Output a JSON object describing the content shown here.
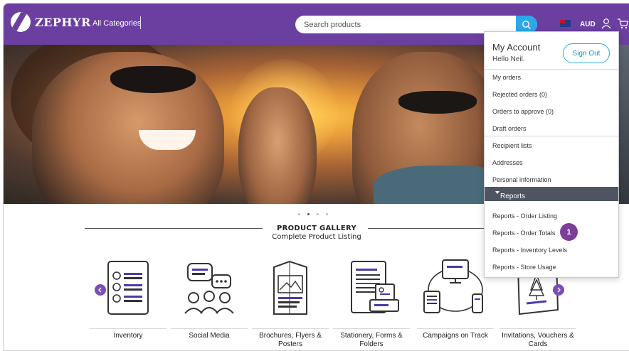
{
  "header": {
    "brand": "ZEPHYR",
    "all_categories": "All Categories",
    "search_placeholder": "Search products",
    "currency": "AUD"
  },
  "hero": {
    "carousel_count": 4,
    "active_index": 1
  },
  "gallery": {
    "title": "PRODUCT GALLERY",
    "subtitle": "Complete Product Listing",
    "categories": [
      {
        "label": "Inventory",
        "icon": "inventory-checklist-icon"
      },
      {
        "label": "Social Media",
        "icon": "social-media-people-icon"
      },
      {
        "label": "Brochures, Flyers & Posters",
        "icon": "brochure-icon"
      },
      {
        "label": "Stationery, Forms & Folders",
        "icon": "stationery-icon"
      },
      {
        "label": "Campaigns on Track",
        "icon": "campaign-devices-icon"
      },
      {
        "label": "Invitations, Vouchers & Cards",
        "icon": "invitation-card-icon"
      }
    ]
  },
  "account_menu": {
    "title": "My Account",
    "greeting": "Hello Neil.",
    "sign_out": "Sign Out",
    "items": [
      "My orders",
      "Rejected orders (0)",
      "Orders to approve (0)",
      "Draft orders",
      "Recipient lists",
      "Addresses",
      "Personal information"
    ],
    "reports_label": "Reports",
    "reports_items": [
      "Reports - Order Listing",
      "Reports - Order Totals",
      "Reports - Inventory Levels",
      "Reports - Store Usage"
    ]
  },
  "annotation": {
    "step": "1"
  },
  "colors": {
    "brand_purple": "#6b3fa0",
    "search_blue": "#2aa8ea",
    "reports_bar": "#4e5561",
    "badge": "#7c3d9b"
  }
}
